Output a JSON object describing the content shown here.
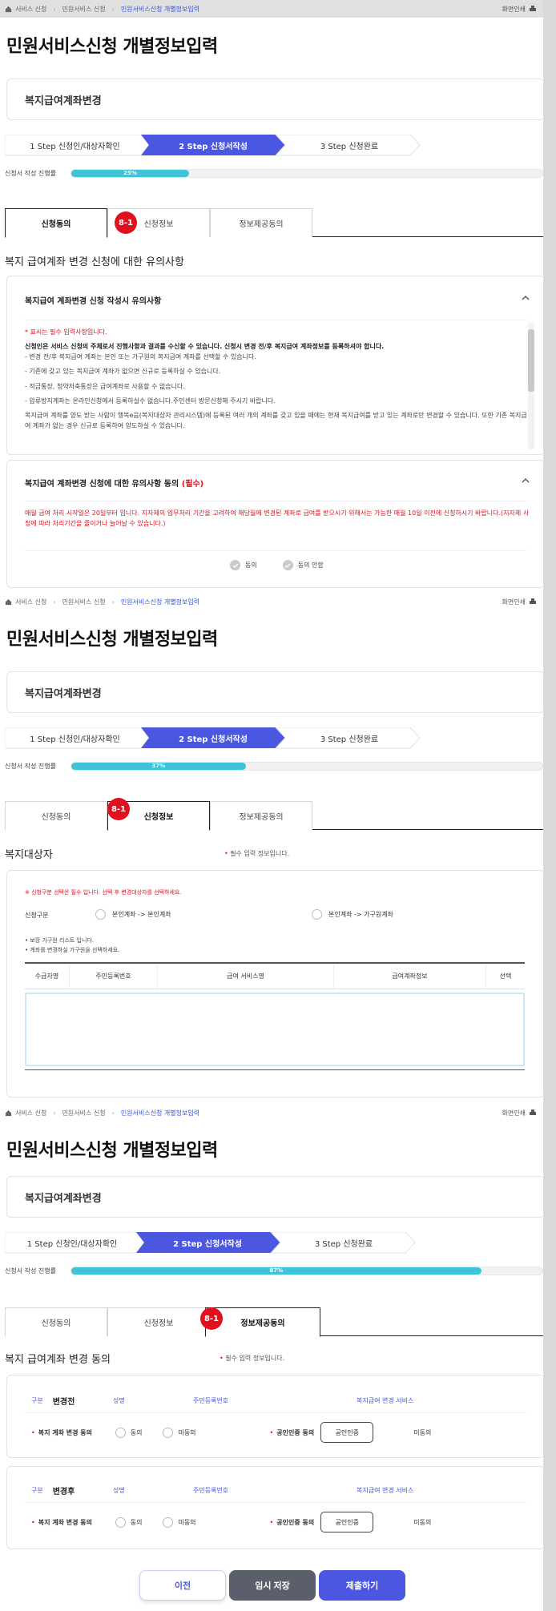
{
  "breadcrumb": [
    "서비스 신청",
    "민원서비스 신청",
    "민원서비스신청 개별정보입력"
  ],
  "print_label": "화면인쇄",
  "page_title": "민원서비스신청 개별정보입력",
  "service_name": "복지급여계좌변경",
  "steps": [
    "1 Step 신청인/대상자확인",
    "2 Step 신청서작성",
    "3 Step 신청완료"
  ],
  "progress_label": "신청서 작성 진행률",
  "tabs": [
    "신청동의",
    "신청정보",
    "정보제공동의"
  ],
  "badge": "8-1",
  "screens": {
    "s1": {
      "progress_value": "25%",
      "progress": 0.25,
      "section_title": "복지 급여계좌 변경 신청에 대한 유의사항",
      "panel1_title": "복지급여 계좌변경 신청 작성시 유의사항",
      "notice": [
        "* 표시는 필수 입력사항입니다.",
        "신청인은 서비스 신청의 주체로서 진행사항과 결과를 수신할 수 있습니다. 신청시 변경 전/후 복지급여 계좌정보를 등록하셔야 합니다.",
        "- 변경 전/후 복지급여 계좌는 본인 또는 가구원의 복지급여 계좌를 선택할 수 있습니다.",
        "- 기존에 갖고 있는 복지급여 계좌가 없으면 신규로 등록하실 수 있습니다.",
        "- 적금통장, 청약저축통장은 급여계좌로 사용할 수 없습니다.",
        "- 압류방지계좌는 온라인신청에서 등록하실수 없습니다.주민센터 방문신청해 주시기 바랍니다.",
        "복지급여 계좌를 양도 받는 사람이 행복e음(복지대상자 관리시스템)에 등록된 여러 개의 계좌를 갖고 있을 때에는 현재 복지급여를 받고 있는 계좌로만 변경할 수 있습니다. 또한 기존 복지급여 계좌가 없는 경우 신규로 등록하여 양도하실 수 있습니다."
      ],
      "panel2_title": "복지급여 계좌변경 신청에 대한 유의사항 동의",
      "panel2_required": "(필수)",
      "panel2_body": "매월 급여 처리 시작일은 20일부터 입니다. 지자체의 업무처리 기간을 고려하여 해당월에 변경된 계좌로 급여를 받으시기 위해서는 가능한 매월 10일 이전에 신청하시기 바랍니다.(지자체 사정에 따라 처리기간을 줄이거나 늘어날 수 있습니다.)",
      "agree": "동의",
      "disagree": "동의 안함"
    },
    "s2": {
      "progress_value": "37%",
      "progress": 0.37,
      "section_title": "복지대상자",
      "required_note": "필수 입력 정보입니다.",
      "red_note": "※ 신청구분 선택은 필수 입니다. 선택 후 변경대상자를 선택하세요.",
      "type_label": "신청구분",
      "option1": "본인계좌 -> 본인계좌",
      "option2": "본인계좌 -> 가구원계좌",
      "bullets": [
        "보장 가구원 리스트 입니다.",
        "계좌를 변경하실 가구원을 선택하세요."
      ],
      "columns": [
        "수급자명",
        "주민등록번호",
        "급여 서비스명",
        "급여계좌정보",
        "선택"
      ]
    },
    "s3": {
      "progress_value": "87%",
      "progress": 0.87,
      "section_title": "복지 급여계좌 변경 동의",
      "required_note": "필수 입력 정보입니다.",
      "blocks": [
        {
          "kind_label": "구분",
          "kind_value": "변경전",
          "cols": [
            "성명",
            "주민등록번호",
            "복지급여 변경 서비스"
          ],
          "consent_label": "복지 계좌 변경 동의",
          "agree": "동의",
          "disagree": "미동의",
          "cert_label": "공인인증 동의",
          "cert_button": "공인인증",
          "cert_status": "미동의"
        },
        {
          "kind_label": "구분",
          "kind_value": "변경후",
          "cols": [
            "성명",
            "주민등록번호",
            "복지급여 변경 서비스"
          ],
          "consent_label": "복지 계좌 변경 동의",
          "agree": "동의",
          "disagree": "미동의",
          "cert_label": "공인인증 동의",
          "cert_button": "공인인증",
          "cert_status": "미동의"
        }
      ]
    }
  },
  "buttons": {
    "prev": "이전",
    "save": "임시 저장",
    "submit": "제출하기"
  },
  "colors": {
    "accent": "#4b57e0",
    "progress": "#3fc3d6",
    "badge": "#e0101f"
  }
}
